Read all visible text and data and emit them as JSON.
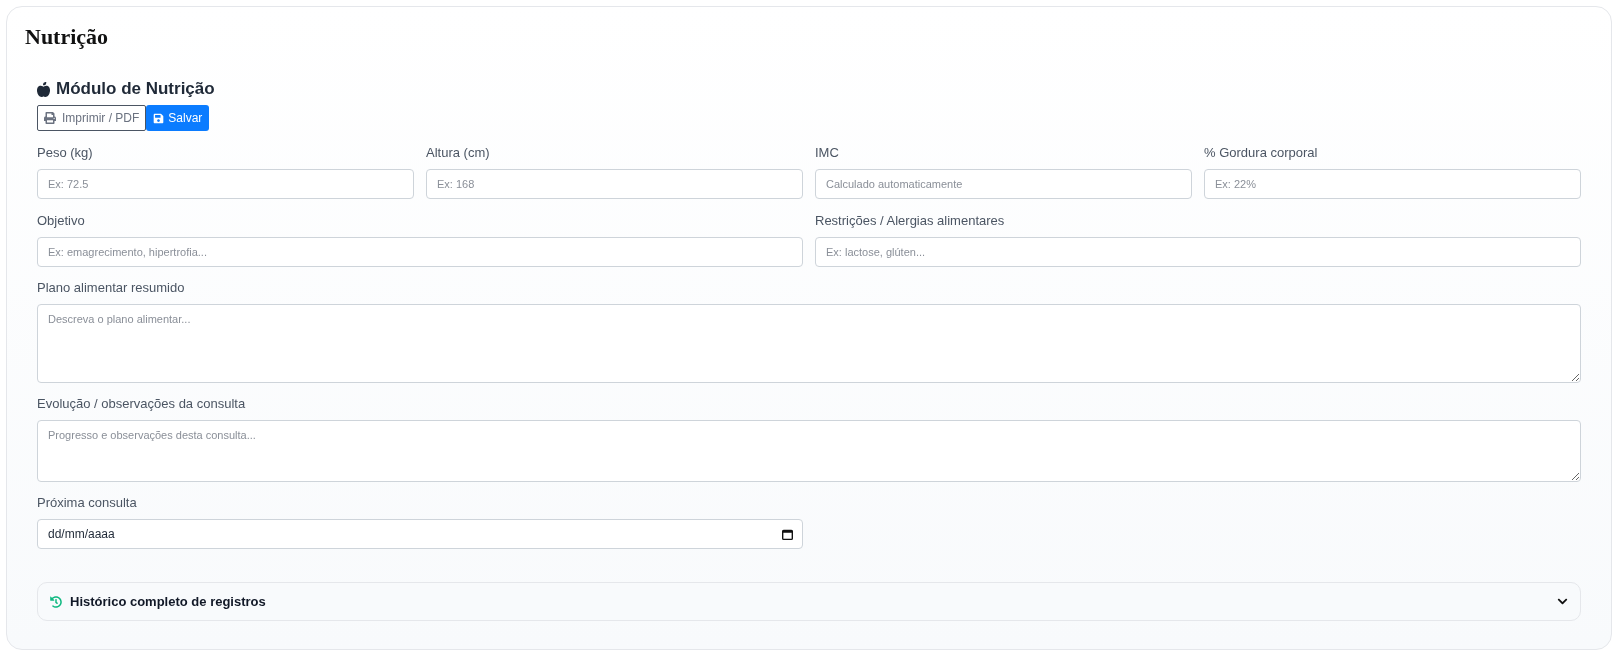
{
  "page": {
    "title": "Nutrição"
  },
  "module": {
    "title": "Módulo de Nutrição",
    "actions": [
      {
        "label": "Imprimir / PDF",
        "kind": "print"
      },
      {
        "label": "Salvar",
        "kind": "save"
      }
    ]
  },
  "measures": [
    {
      "label": "Peso (kg)",
      "placeholder": "Ex: 72.5"
    },
    {
      "label": "Altura (cm)",
      "placeholder": "Ex: 168"
    },
    {
      "label": "IMC",
      "placeholder": "Calculado automaticamente"
    },
    {
      "label": "% Gordura corporal",
      "placeholder": "Ex: 22%"
    }
  ],
  "profile": [
    {
      "label": "Objetivo",
      "placeholder": "Ex: emagrecimento, hipertrofia..."
    },
    {
      "label": "Restrições / Alergias alimentares",
      "placeholder": "Ex: lactose, glúten..."
    }
  ],
  "notes": [
    {
      "label": "Plano alimentar resumido",
      "placeholder": "Descreva o plano alimentar..."
    },
    {
      "label": "Evolução / observações da consulta",
      "placeholder": "Progresso e observações desta consulta..."
    }
  ],
  "next_visit": {
    "label": "Próxima consulta",
    "placeholder": "dd/mm/aaaa"
  },
  "history": {
    "title": "Histórico completo de registros",
    "expanded": false
  }
}
